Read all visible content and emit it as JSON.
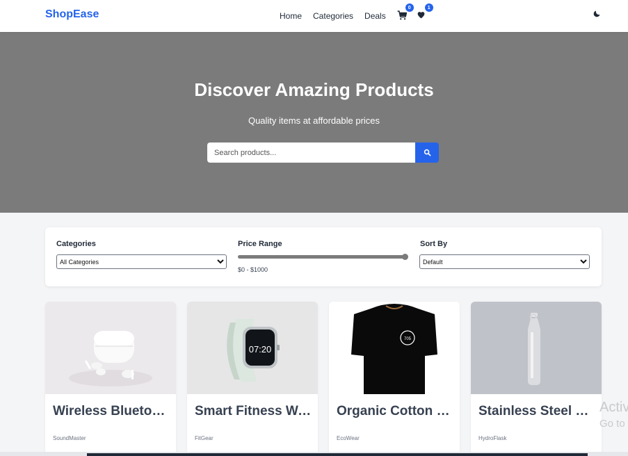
{
  "navbar": {
    "brand": "ShopEase",
    "links": [
      "Home",
      "Categories",
      "Deals"
    ],
    "cart_count": "0",
    "wishlist_count": "1"
  },
  "hero": {
    "title": "Discover Amazing Products",
    "subtitle": "Quality items at affordable prices",
    "search_placeholder": "Search products..."
  },
  "filters": {
    "categories_label": "Categories",
    "categories_selected": "All Categories",
    "price_label": "Price Range",
    "price_text": "$0 - $1000",
    "price_max_fraction": 1.0,
    "sort_label": "Sort By",
    "sort_selected": "Default"
  },
  "products": [
    {
      "name": "Wireless Bluetooth Earbuds",
      "brand": "SoundMaster",
      "image_icon": "earbuds-image"
    },
    {
      "name": "Smart Fitness Watch",
      "brand": "FitGear",
      "image_icon": "smartwatch-image"
    },
    {
      "name": "Organic Cotton T-Shirt",
      "brand": "EcoWear",
      "image_icon": "tshirt-image"
    },
    {
      "name": "Stainless Steel Water Bottle",
      "brand": "HydroFlask",
      "image_icon": "bottle-image"
    }
  ],
  "watch_time": "07:20",
  "tshirt_logo": "705",
  "watermark": {
    "line1": "Activ",
    "line2": "Go to"
  },
  "colors": {
    "accent": "#2563eb",
    "hero_bg": "#7b7b7c"
  }
}
